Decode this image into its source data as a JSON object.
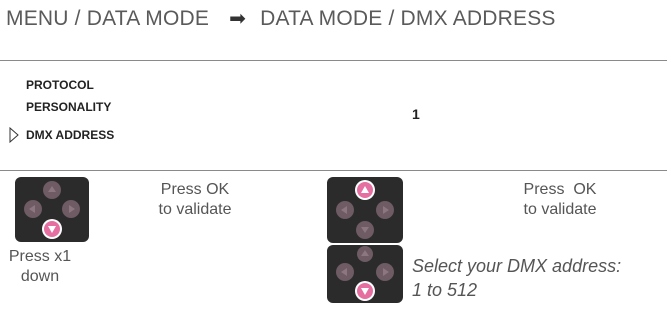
{
  "header": {
    "title_left": "MENU / DATA MODE",
    "arrow_icon": "right-arrow-icon",
    "title_right": "DATA MODE / DMX ADDRESS"
  },
  "menu": {
    "items": [
      "PROTOCOL",
      "PERSONALITY",
      "DMX ADDRESS"
    ],
    "selected_index": 2,
    "selected_value": "1"
  },
  "step1": {
    "pad_active_button": "down",
    "ok_caption_line1": "Press OK",
    "ok_caption_line2": "to validate",
    "press_caption_line1": "Press x1",
    "press_caption_line2": "down"
  },
  "step2": {
    "pad_top_active_button": "up",
    "pad_bottom_active_button": "down",
    "ok_caption_line1": "Press  OK",
    "ok_caption_line2": "to validate",
    "select_line1": "Select your DMX address:",
    "select_line2": "1 to 512"
  },
  "colors": {
    "pad_bg": "#2b2b2b",
    "button_idle": "#6e5b64",
    "button_active": "#e56fa0"
  }
}
